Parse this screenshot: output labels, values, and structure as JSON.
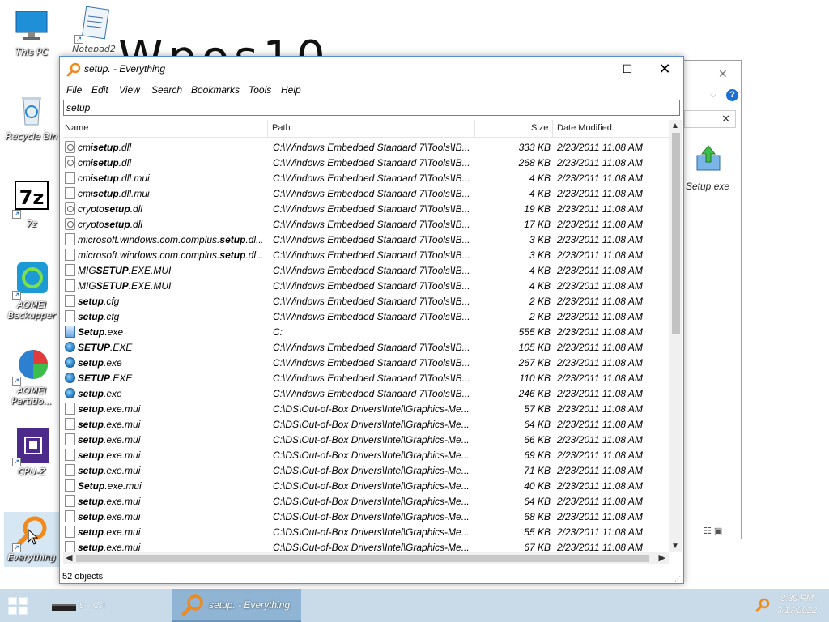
{
  "desktop": {
    "watermark": "Wpos10",
    "icons": [
      {
        "label": "This PC",
        "icon": "monitor-icon"
      },
      {
        "label": "Notepad2",
        "icon": "notepad-icon"
      },
      {
        "label": "Recycle Bin",
        "icon": "recycle-bin-icon"
      },
      {
        "label": "7z",
        "icon": "7zip-icon"
      },
      {
        "label": "AOMEI Backupper",
        "icon": "backupper-icon"
      },
      {
        "label": "AOMEI Partitio...",
        "icon": "partition-icon"
      },
      {
        "label": "CPU-Z",
        "icon": "cpu-icon"
      },
      {
        "label": "Everything",
        "icon": "magnifier-icon"
      }
    ]
  },
  "background_window": {
    "file_label": "Setup.exe",
    "close_glyph": "✕",
    "help_glyph": "?",
    "search_clear": "✕"
  },
  "window": {
    "title": "setup. - Everything",
    "controls": {
      "minimize": "—",
      "maximize": "☐",
      "close": "✕"
    },
    "menu": [
      "File",
      "Edit",
      "View",
      "Search",
      "Bookmarks",
      "Tools",
      "Help"
    ],
    "search_value": "setup.",
    "columns": {
      "name": "Name",
      "path": "Path",
      "size": "Size",
      "date": "Date Modified"
    },
    "rows": [
      {
        "pre": "cmi",
        "hit": "setup",
        "post": ".dll",
        "path": "C:\\Windows Embedded Standard 7\\Tools\\IB...",
        "size": "333 KB",
        "date": "2/23/2011 11:08 AM",
        "icon": "gear"
      },
      {
        "pre": "cmi",
        "hit": "setup",
        "post": ".dll",
        "path": "C:\\Windows Embedded Standard 7\\Tools\\IB...",
        "size": "268 KB",
        "date": "2/23/2011 11:08 AM",
        "icon": "gear"
      },
      {
        "pre": "cmi",
        "hit": "setup",
        "post": ".dll.mui",
        "path": "C:\\Windows Embedded Standard 7\\Tools\\IB...",
        "size": "4 KB",
        "date": "2/23/2011 11:08 AM",
        "icon": "doc"
      },
      {
        "pre": "cmi",
        "hit": "setup",
        "post": ".dll.mui",
        "path": "C:\\Windows Embedded Standard 7\\Tools\\IB...",
        "size": "4 KB",
        "date": "2/23/2011 11:08 AM",
        "icon": "doc"
      },
      {
        "pre": "crypto",
        "hit": "setup",
        "post": ".dll",
        "path": "C:\\Windows Embedded Standard 7\\Tools\\IB...",
        "size": "19 KB",
        "date": "2/23/2011 11:08 AM",
        "icon": "gear"
      },
      {
        "pre": "crypto",
        "hit": "setup",
        "post": ".dll",
        "path": "C:\\Windows Embedded Standard 7\\Tools\\IB...",
        "size": "17 KB",
        "date": "2/23/2011 11:08 AM",
        "icon": "gear"
      },
      {
        "pre": "microsoft.windows.com.complus.",
        "hit": "setup",
        "post": ".dl...",
        "path": "C:\\Windows Embedded Standard 7\\Tools\\IB...",
        "size": "3 KB",
        "date": "2/23/2011 11:08 AM",
        "icon": "doc"
      },
      {
        "pre": "microsoft.windows.com.complus.",
        "hit": "setup",
        "post": ".dl...",
        "path": "C:\\Windows Embedded Standard 7\\Tools\\IB...",
        "size": "3 KB",
        "date": "2/23/2011 11:08 AM",
        "icon": "doc"
      },
      {
        "pre": "MIG",
        "hit": "SETUP",
        "post": ".EXE.MUI",
        "path": "C:\\Windows Embedded Standard 7\\Tools\\IB...",
        "size": "4 KB",
        "date": "2/23/2011 11:08 AM",
        "icon": "doc"
      },
      {
        "pre": "MIG",
        "hit": "SETUP",
        "post": ".EXE.MUI",
        "path": "C:\\Windows Embedded Standard 7\\Tools\\IB...",
        "size": "4 KB",
        "date": "2/23/2011 11:08 AM",
        "icon": "doc"
      },
      {
        "pre": "",
        "hit": "setup",
        "post": ".cfg",
        "path": "C:\\Windows Embedded Standard 7\\Tools\\IB...",
        "size": "2 KB",
        "date": "2/23/2011 11:08 AM",
        "icon": "doc"
      },
      {
        "pre": "",
        "hit": "setup",
        "post": ".cfg",
        "path": "C:\\Windows Embedded Standard 7\\Tools\\IB...",
        "size": "2 KB",
        "date": "2/23/2011 11:08 AM",
        "icon": "doc"
      },
      {
        "pre": "",
        "hit": "Setup",
        "post": ".exe",
        "path": "C:",
        "size": "555 KB",
        "date": "2/23/2011 11:08 AM",
        "icon": "exe2"
      },
      {
        "pre": "",
        "hit": "SETUP",
        "post": ".EXE",
        "path": "C:\\Windows Embedded Standard 7\\Tools\\IB...",
        "size": "105 KB",
        "date": "2/23/2011 11:08 AM",
        "icon": "exe"
      },
      {
        "pre": "",
        "hit": "setup",
        "post": ".exe",
        "path": "C:\\Windows Embedded Standard 7\\Tools\\IB...",
        "size": "267 KB",
        "date": "2/23/2011 11:08 AM",
        "icon": "exe"
      },
      {
        "pre": "",
        "hit": "SETUP",
        "post": ".EXE",
        "path": "C:\\Windows Embedded Standard 7\\Tools\\IB...",
        "size": "110 KB",
        "date": "2/23/2011 11:08 AM",
        "icon": "exe"
      },
      {
        "pre": "",
        "hit": "setup",
        "post": ".exe",
        "path": "C:\\Windows Embedded Standard 7\\Tools\\IB...",
        "size": "246 KB",
        "date": "2/23/2011 11:08 AM",
        "icon": "exe"
      },
      {
        "pre": "",
        "hit": "setup",
        "post": ".exe.mui",
        "path": "C:\\DS\\Out-of-Box Drivers\\Intel\\Graphics-Me...",
        "size": "57 KB",
        "date": "2/23/2011 11:08 AM",
        "icon": "doc"
      },
      {
        "pre": "",
        "hit": "setup",
        "post": ".exe.mui",
        "path": "C:\\DS\\Out-of-Box Drivers\\Intel\\Graphics-Me...",
        "size": "64 KB",
        "date": "2/23/2011 11:08 AM",
        "icon": "doc"
      },
      {
        "pre": "",
        "hit": "setup",
        "post": ".exe.mui",
        "path": "C:\\DS\\Out-of-Box Drivers\\Intel\\Graphics-Me...",
        "size": "66 KB",
        "date": "2/23/2011 11:08 AM",
        "icon": "doc"
      },
      {
        "pre": "",
        "hit": "setup",
        "post": ".exe.mui",
        "path": "C:\\DS\\Out-of-Box Drivers\\Intel\\Graphics-Me...",
        "size": "69 KB",
        "date": "2/23/2011 11:08 AM",
        "icon": "doc"
      },
      {
        "pre": "",
        "hit": "setup",
        "post": ".exe.mui",
        "path": "C:\\DS\\Out-of-Box Drivers\\Intel\\Graphics-Me...",
        "size": "71 KB",
        "date": "2/23/2011 11:08 AM",
        "icon": "doc"
      },
      {
        "pre": "",
        "hit": "Setup",
        "post": ".exe.mui",
        "path": "C:\\DS\\Out-of-Box Drivers\\Intel\\Graphics-Me...",
        "size": "40 KB",
        "date": "2/23/2011 11:08 AM",
        "icon": "doc"
      },
      {
        "pre": "",
        "hit": "setup",
        "post": ".exe.mui",
        "path": "C:\\DS\\Out-of-Box Drivers\\Intel\\Graphics-Me...",
        "size": "64 KB",
        "date": "2/23/2011 11:08 AM",
        "icon": "doc"
      },
      {
        "pre": "",
        "hit": "setup",
        "post": ".exe.mui",
        "path": "C:\\DS\\Out-of-Box Drivers\\Intel\\Graphics-Me...",
        "size": "68 KB",
        "date": "2/23/2011 11:08 AM",
        "icon": "doc"
      },
      {
        "pre": "",
        "hit": "setup",
        "post": ".exe.mui",
        "path": "C:\\DS\\Out-of-Box Drivers\\Intel\\Graphics-Me...",
        "size": "55 KB",
        "date": "2/23/2011 11:08 AM",
        "icon": "doc"
      },
      {
        "pre": "",
        "hit": "setup",
        "post": ".exe.mui",
        "path": "C:\\DS\\Out-of-Box Drivers\\Intel\\Graphics-Me...",
        "size": "67 KB",
        "date": "2/23/2011 11:08 AM",
        "icon": "doc"
      }
    ],
    "status": "52 objects"
  },
  "taskbar": {
    "cmd_label": "s - C:\\",
    "everything_label": "setup. - Everything",
    "clock_time": "8:39 PM",
    "clock_date": "3/17/2022"
  },
  "colors": {
    "accent": "#2f7fd8",
    "taskbar": "#c9dbe9",
    "active_task": "#8fb4d4",
    "everything_orange": "#f08a1c"
  }
}
